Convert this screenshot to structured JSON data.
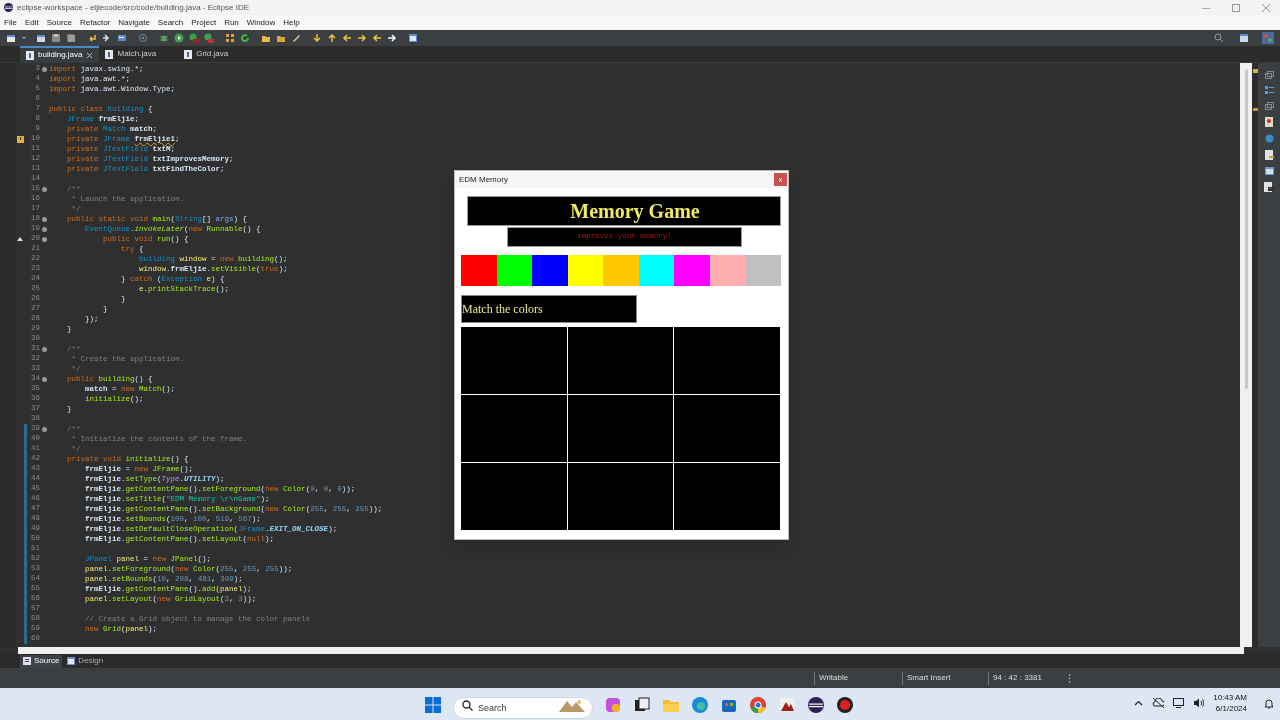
{
  "window": {
    "title": "eclipse-workspace - eljiecode/src/code/building.java - Eclipse IDE"
  },
  "menu": [
    "File",
    "Edit",
    "Source",
    "Refactor",
    "Navigate",
    "Search",
    "Project",
    "Run",
    "Window",
    "Help"
  ],
  "editor_tabs": [
    {
      "label": "building.java",
      "selected": true
    },
    {
      "label": "Match.java",
      "selected": false
    },
    {
      "label": "Grid.java",
      "selected": false
    }
  ],
  "code_lines": [
    {
      "number": "3",
      "fold": true,
      "changed": false,
      "tokens": [
        {
          "kind": "kw",
          "text": "import"
        },
        {
          "kind": "plain",
          "text": " javax.swing.*;"
        }
      ]
    },
    {
      "number": "4",
      "fold": false,
      "changed": false,
      "tokens": [
        {
          "kind": "kw",
          "text": "import"
        },
        {
          "kind": "plain",
          "text": " java.awt.*;"
        }
      ]
    },
    {
      "number": "5",
      "fold": false,
      "changed": false,
      "tokens": [
        {
          "kind": "kw",
          "text": "import"
        },
        {
          "kind": "plain",
          "text": " java.awt.Window.Type;"
        }
      ]
    },
    {
      "number": "6",
      "fold": false,
      "changed": false
    },
    {
      "number": "7",
      "fold": false,
      "changed": false,
      "tokens": [
        {
          "kind": "kw",
          "text": "public class "
        },
        {
          "kind": "type",
          "text": "building"
        },
        {
          "kind": "plain",
          "text": " {"
        }
      ]
    },
    {
      "number": "8",
      "fold": false,
      "changed": false,
      "tokens": [
        {
          "kind": "type",
          "text": "    JFrame "
        },
        {
          "kind": "field",
          "text": "frmEljie"
        },
        {
          "kind": "plain",
          "text": ";"
        }
      ]
    },
    {
      "number": "9",
      "fold": false,
      "changed": false,
      "tokens": [
        {
          "kind": "kw",
          "text": "    private "
        },
        {
          "kind": "type",
          "text": "Match "
        },
        {
          "kind": "field",
          "text": "match"
        },
        {
          "kind": "plain",
          "text": ";"
        }
      ]
    },
    {
      "number": "10",
      "fold": false,
      "changed": false,
      "marker": {
        "kind": "warning"
      },
      "tokens": [
        {
          "kind": "kw",
          "text": "    private "
        },
        {
          "kind": "type",
          "text": "JFrame "
        },
        {
          "kind": "warn",
          "text": "frmEljie1"
        },
        {
          "kind": "plain",
          "text": ";"
        }
      ]
    },
    {
      "number": "11",
      "fold": false,
      "changed": false,
      "tokens": [
        {
          "kind": "kw",
          "text": "    private "
        },
        {
          "kind": "type",
          "text": "JTextField "
        },
        {
          "kind": "field",
          "text": "txtM"
        },
        {
          "kind": "plain",
          "text": ";"
        }
      ]
    },
    {
      "number": "12",
      "fold": false,
      "changed": false,
      "tokens": [
        {
          "kind": "kw",
          "text": "    private "
        },
        {
          "kind": "type",
          "text": "JTextField "
        },
        {
          "kind": "field",
          "text": "txtImprovesMemory"
        },
        {
          "kind": "plain",
          "text": ";"
        }
      ]
    },
    {
      "number": "13",
      "fold": false,
      "changed": false,
      "tokens": [
        {
          "kind": "kw",
          "text": "    private "
        },
        {
          "kind": "type",
          "text": "JTextField "
        },
        {
          "kind": "field",
          "text": "txtFindTheColor"
        },
        {
          "kind": "plain",
          "text": ";"
        }
      ]
    },
    {
      "number": "14",
      "fold": false,
      "changed": false
    },
    {
      "number": "15",
      "fold": true,
      "changed": false,
      "tokens": [
        {
          "kind": "com",
          "text": "    /**"
        }
      ]
    },
    {
      "number": "16",
      "fold": false,
      "changed": false,
      "tokens": [
        {
          "kind": "com",
          "text": "     * Launch the application."
        }
      ]
    },
    {
      "number": "17",
      "fold": false,
      "changed": false,
      "tokens": [
        {
          "kind": "com",
          "text": "     */"
        }
      ]
    },
    {
      "number": "18",
      "fold": true,
      "changed": false,
      "tokens": [
        {
          "kind": "kw",
          "text": "    public static void "
        },
        {
          "kind": "method",
          "text": "main"
        },
        {
          "kind": "plain",
          "text": "("
        },
        {
          "kind": "type",
          "text": "String"
        },
        {
          "kind": "plain",
          "text": "[] "
        },
        {
          "kind": "param",
          "text": "args"
        },
        {
          "kind": "plain",
          "text": ") {"
        }
      ]
    },
    {
      "number": "19",
      "fold": true,
      "changed": false,
      "tokens": [
        {
          "kind": "type",
          "text": "        EventQueue"
        },
        {
          "kind": "plain",
          "text": "."
        },
        {
          "kind": "smethod",
          "text": "invokeLater"
        },
        {
          "kind": "plain",
          "text": "("
        },
        {
          "kind": "kw",
          "text": "new "
        },
        {
          "kind": "method",
          "text": "Runnable"
        },
        {
          "kind": "plain",
          "text": "() {"
        }
      ]
    },
    {
      "number": "20",
      "fold": true,
      "changed": false,
      "marker": {
        "kind": "override"
      },
      "tokens": [
        {
          "kind": "kw",
          "text": "            public void "
        },
        {
          "kind": "method",
          "text": "run"
        },
        {
          "kind": "plain",
          "text": "() {"
        }
      ]
    },
    {
      "number": "21",
      "fold": false,
      "changed": false,
      "tokens": [
        {
          "kind": "kw",
          "text": "                try"
        },
        {
          "kind": "plain",
          "text": " {"
        }
      ]
    },
    {
      "number": "22",
      "fold": false,
      "changed": false,
      "tokens": [
        {
          "kind": "type",
          "text": "                    building "
        },
        {
          "kind": "local",
          "text": "window"
        },
        {
          "kind": "plain",
          "text": " = "
        },
        {
          "kind": "kw",
          "text": "new "
        },
        {
          "kind": "method",
          "text": "building"
        },
        {
          "kind": "plain",
          "text": "();"
        }
      ]
    },
    {
      "number": "23",
      "fold": false,
      "changed": false,
      "tokens": [
        {
          "kind": "local",
          "text": "                    window"
        },
        {
          "kind": "plain",
          "text": "."
        },
        {
          "kind": "field",
          "text": "frmEljie"
        },
        {
          "kind": "plain",
          "text": "."
        },
        {
          "kind": "method",
          "text": "setVisible"
        },
        {
          "kind": "plain",
          "text": "("
        },
        {
          "kind": "kw",
          "text": "true"
        },
        {
          "kind": "plain",
          "text": ");"
        }
      ]
    },
    {
      "number": "24",
      "fold": false,
      "changed": false,
      "tokens": [
        {
          "kind": "plain",
          "text": "                } "
        },
        {
          "kind": "kw",
          "text": "catch"
        },
        {
          "kind": "plain",
          "text": " ("
        },
        {
          "kind": "type",
          "text": "Exception "
        },
        {
          "kind": "local",
          "text": "e"
        },
        {
          "kind": "plain",
          "text": ") {"
        }
      ]
    },
    {
      "number": "25",
      "fold": false,
      "changed": false,
      "tokens": [
        {
          "kind": "local",
          "text": "                    e"
        },
        {
          "kind": "plain",
          "text": "."
        },
        {
          "kind": "method",
          "text": "printStackTrace"
        },
        {
          "kind": "plain",
          "text": "();"
        }
      ]
    },
    {
      "number": "26",
      "fold": false,
      "changed": false,
      "tokens": [
        {
          "kind": "plain",
          "text": "                }"
        }
      ]
    },
    {
      "number": "27",
      "fold": false,
      "changed": false,
      "tokens": [
        {
          "kind": "plain",
          "text": "            }"
        }
      ]
    },
    {
      "number": "28",
      "fold": false,
      "changed": false,
      "tokens": [
        {
          "kind": "plain",
          "text": "        });"
        }
      ]
    },
    {
      "number": "29",
      "fold": false,
      "changed": false,
      "tokens": [
        {
          "kind": "plain",
          "text": "    }"
        }
      ]
    },
    {
      "number": "30",
      "fold": false,
      "changed": false
    },
    {
      "number": "31",
      "fold": true,
      "changed": false,
      "tokens": [
        {
          "kind": "com",
          "text": "    /**"
        }
      ]
    },
    {
      "number": "32",
      "fold": false,
      "changed": false,
      "tokens": [
        {
          "kind": "com",
          "text": "     * Create the application."
        }
      ]
    },
    {
      "number": "33",
      "fold": false,
      "changed": false,
      "tokens": [
        {
          "kind": "com",
          "text": "     */"
        }
      ]
    },
    {
      "number": "34",
      "fold": true,
      "changed": false,
      "tokens": [
        {
          "kind": "kw",
          "text": "    public "
        },
        {
          "kind": "method",
          "text": "building"
        },
        {
          "kind": "plain",
          "text": "() {"
        }
      ]
    },
    {
      "number": "35",
      "fold": false,
      "changed": false,
      "tokens": [
        {
          "kind": "field",
          "text": "        match"
        },
        {
          "kind": "plain",
          "text": " = "
        },
        {
          "kind": "kw",
          "text": "new "
        },
        {
          "kind": "method",
          "text": "Match"
        },
        {
          "kind": "plain",
          "text": "();"
        }
      ]
    },
    {
      "number": "36",
      "fold": false,
      "changed": false,
      "tokens": [
        {
          "kind": "method",
          "text": "        initialize"
        },
        {
          "kind": "plain",
          "text": "();"
        }
      ]
    },
    {
      "number": "37",
      "fold": false,
      "changed": false,
      "tokens": [
        {
          "kind": "plain",
          "text": "    }"
        }
      ]
    },
    {
      "number": "38",
      "fold": false,
      "changed": false
    },
    {
      "number": "39",
      "fold": true,
      "changed": true,
      "tokens": [
        {
          "kind": "com",
          "text": "    /**"
        }
      ]
    },
    {
      "number": "40",
      "fold": false,
      "changed": true,
      "tokens": [
        {
          "kind": "com",
          "text": "     * Initialize the contents of the frame."
        }
      ]
    },
    {
      "number": "41",
      "fold": false,
      "changed": true,
      "tokens": [
        {
          "kind": "com",
          "text": "     */"
        }
      ]
    },
    {
      "number": "42",
      "fold": false,
      "changed": true,
      "tokens": [
        {
          "kind": "kw",
          "text": "    private void "
        },
        {
          "kind": "method",
          "text": "initialize"
        },
        {
          "kind": "plain",
          "text": "() {"
        }
      ]
    },
    {
      "number": "43",
      "fold": false,
      "changed": true,
      "tokens": [
        {
          "kind": "field",
          "text": "        frmEljie"
        },
        {
          "kind": "plain",
          "text": " = "
        },
        {
          "kind": "kw",
          "text": "new "
        },
        {
          "kind": "method",
          "text": "JFrame"
        },
        {
          "kind": "plain",
          "text": "();"
        }
      ]
    },
    {
      "number": "44",
      "fold": false,
      "changed": true,
      "tokens": [
        {
          "kind": "field",
          "text": "        frmEljie"
        },
        {
          "kind": "plain",
          "text": "."
        },
        {
          "kind": "method",
          "text": "setType"
        },
        {
          "kind": "plain",
          "text": "("
        },
        {
          "kind": "itype",
          "text": "Type"
        },
        {
          "kind": "plain",
          "text": "."
        },
        {
          "kind": "const",
          "text": "UTILITY"
        },
        {
          "kind": "plain",
          "text": ");"
        }
      ]
    },
    {
      "number": "45",
      "fold": false,
      "changed": true,
      "tokens": [
        {
          "kind": "field",
          "text": "        frmEljie"
        },
        {
          "kind": "plain",
          "text": "."
        },
        {
          "kind": "method",
          "text": "getContentPane"
        },
        {
          "kind": "plain",
          "text": "()."
        },
        {
          "kind": "method",
          "text": "setForeground"
        },
        {
          "kind": "plain",
          "text": "("
        },
        {
          "kind": "kw",
          "text": "new "
        },
        {
          "kind": "method",
          "text": "Color"
        },
        {
          "kind": "plain",
          "text": "("
        },
        {
          "kind": "num",
          "text": "0"
        },
        {
          "kind": "plain",
          "text": ", "
        },
        {
          "kind": "num",
          "text": "0"
        },
        {
          "kind": "plain",
          "text": ", "
        },
        {
          "kind": "num",
          "text": "0"
        },
        {
          "kind": "plain",
          "text": "));"
        }
      ]
    },
    {
      "number": "46",
      "fold": false,
      "changed": true,
      "tokens": [
        {
          "kind": "field",
          "text": "        frmEljie"
        },
        {
          "kind": "plain",
          "text": "."
        },
        {
          "kind": "method",
          "text": "setTitle"
        },
        {
          "kind": "plain",
          "text": "("
        },
        {
          "kind": "str",
          "text": "\"EDM Memory \\r\\nGame\""
        },
        {
          "kind": "plain",
          "text": ");"
        }
      ]
    },
    {
      "number": "47",
      "fold": false,
      "changed": true,
      "tokens": [
        {
          "kind": "field",
          "text": "        frmEljie"
        },
        {
          "kind": "plain",
          "text": "."
        },
        {
          "kind": "method",
          "text": "getContentPane"
        },
        {
          "kind": "plain",
          "text": "()."
        },
        {
          "kind": "method",
          "text": "setBackground"
        },
        {
          "kind": "plain",
          "text": "("
        },
        {
          "kind": "kw",
          "text": "new "
        },
        {
          "kind": "method",
          "text": "Color"
        },
        {
          "kind": "plain",
          "text": "("
        },
        {
          "kind": "num",
          "text": "255"
        },
        {
          "kind": "plain",
          "text": ", "
        },
        {
          "kind": "num",
          "text": "255"
        },
        {
          "kind": "plain",
          "text": ", "
        },
        {
          "kind": "num",
          "text": "255"
        },
        {
          "kind": "plain",
          "text": "));"
        }
      ]
    },
    {
      "number": "48",
      "fold": false,
      "changed": true,
      "tokens": [
        {
          "kind": "field",
          "text": "        frmEljie"
        },
        {
          "kind": "plain",
          "text": "."
        },
        {
          "kind": "method",
          "text": "setBounds"
        },
        {
          "kind": "plain",
          "text": "("
        },
        {
          "kind": "num",
          "text": "100"
        },
        {
          "kind": "plain",
          "text": ", "
        },
        {
          "kind": "num",
          "text": "100"
        },
        {
          "kind": "plain",
          "text": ", "
        },
        {
          "kind": "num",
          "text": "519"
        },
        {
          "kind": "plain",
          "text": ", "
        },
        {
          "kind": "num",
          "text": "567"
        },
        {
          "kind": "plain",
          "text": ");"
        }
      ]
    },
    {
      "number": "49",
      "fold": false,
      "changed": true,
      "tokens": [
        {
          "kind": "field",
          "text": "        frmEljie"
        },
        {
          "kind": "plain",
          "text": "."
        },
        {
          "kind": "method",
          "text": "setDefaultCloseOperation"
        },
        {
          "kind": "plain",
          "text": "("
        },
        {
          "kind": "type",
          "text": "JFrame"
        },
        {
          "kind": "plain",
          "text": "."
        },
        {
          "kind": "const",
          "text": "EXIT_ON_CLOSE"
        },
        {
          "kind": "plain",
          "text": ");"
        }
      ]
    },
    {
      "number": "50",
      "fold": false,
      "changed": true,
      "tokens": [
        {
          "kind": "field",
          "text": "        frmEljie"
        },
        {
          "kind": "plain",
          "text": "."
        },
        {
          "kind": "method",
          "text": "getContentPane"
        },
        {
          "kind": "plain",
          "text": "()."
        },
        {
          "kind": "method",
          "text": "setLayout"
        },
        {
          "kind": "plain",
          "text": "("
        },
        {
          "kind": "kw",
          "text": "null"
        },
        {
          "kind": "plain",
          "text": ");"
        }
      ]
    },
    {
      "number": "51",
      "fold": false,
      "changed": true
    },
    {
      "number": "52",
      "fold": false,
      "changed": true,
      "tokens": [
        {
          "kind": "type",
          "text": "        JPanel "
        },
        {
          "kind": "local",
          "text": "panel"
        },
        {
          "kind": "plain",
          "text": " = "
        },
        {
          "kind": "kw",
          "text": "new "
        },
        {
          "kind": "method",
          "text": "JPanel"
        },
        {
          "kind": "plain",
          "text": "();"
        }
      ]
    },
    {
      "number": "53",
      "fold": false,
      "changed": true,
      "tokens": [
        {
          "kind": "local",
          "text": "        panel"
        },
        {
          "kind": "plain",
          "text": "."
        },
        {
          "kind": "method",
          "text": "setForeground"
        },
        {
          "kind": "plain",
          "text": "("
        },
        {
          "kind": "kw",
          "text": "new "
        },
        {
          "kind": "method",
          "text": "Color"
        },
        {
          "kind": "plain",
          "text": "("
        },
        {
          "kind": "num",
          "text": "255"
        },
        {
          "kind": "plain",
          "text": ", "
        },
        {
          "kind": "num",
          "text": "255"
        },
        {
          "kind": "plain",
          "text": ", "
        },
        {
          "kind": "num",
          "text": "255"
        },
        {
          "kind": "plain",
          "text": "));"
        }
      ]
    },
    {
      "number": "54",
      "fold": false,
      "changed": true,
      "tokens": [
        {
          "kind": "local",
          "text": "        panel"
        },
        {
          "kind": "plain",
          "text": "."
        },
        {
          "kind": "method",
          "text": "setBounds"
        },
        {
          "kind": "plain",
          "text": "("
        },
        {
          "kind": "num",
          "text": "10"
        },
        {
          "kind": "plain",
          "text": ", "
        },
        {
          "kind": "num",
          "text": "208"
        },
        {
          "kind": "plain",
          "text": ", "
        },
        {
          "kind": "num",
          "text": "481"
        },
        {
          "kind": "plain",
          "text": ", "
        },
        {
          "kind": "num",
          "text": "309"
        },
        {
          "kind": "plain",
          "text": ");"
        }
      ]
    },
    {
      "number": "55",
      "fold": false,
      "changed": true,
      "tokens": [
        {
          "kind": "field",
          "text": "        frmEljie"
        },
        {
          "kind": "plain",
          "text": "."
        },
        {
          "kind": "method",
          "text": "getContentPane"
        },
        {
          "kind": "plain",
          "text": "()."
        },
        {
          "kind": "method",
          "text": "add"
        },
        {
          "kind": "plain",
          "text": "("
        },
        {
          "kind": "local",
          "text": "panel"
        },
        {
          "kind": "plain",
          "text": ");"
        }
      ]
    },
    {
      "number": "56",
      "fold": false,
      "changed": true,
      "tokens": [
        {
          "kind": "local",
          "text": "        panel"
        },
        {
          "kind": "plain",
          "text": "."
        },
        {
          "kind": "method",
          "text": "setLayout"
        },
        {
          "kind": "plain",
          "text": "("
        },
        {
          "kind": "kw",
          "text": "new "
        },
        {
          "kind": "method",
          "text": "GridLayout"
        },
        {
          "kind": "plain",
          "text": "("
        },
        {
          "kind": "num",
          "text": "3"
        },
        {
          "kind": "plain",
          "text": ", "
        },
        {
          "kind": "num",
          "text": "3"
        },
        {
          "kind": "plain",
          "text": "));"
        }
      ]
    },
    {
      "number": "57",
      "fold": false,
      "changed": true
    },
    {
      "number": "58",
      "fold": false,
      "changed": true,
      "tokens": [
        {
          "kind": "com",
          "text": "        // Create a Grid object to manage the color panels"
        }
      ]
    },
    {
      "number": "59",
      "fold": false,
      "changed": true,
      "tokens": [
        {
          "kind": "kw",
          "text": "        new "
        },
        {
          "kind": "method",
          "text": "Grid"
        },
        {
          "kind": "plain",
          "text": "("
        },
        {
          "kind": "local",
          "text": "panel"
        },
        {
          "kind": "plain",
          "text": ");"
        }
      ]
    },
    {
      "number": "60",
      "fold": false,
      "changed": true
    }
  ],
  "dialog": {
    "title": "EDM Memory",
    "close": "x",
    "heading": "Memory Game",
    "subtitle": "improves your memory!",
    "swatches": [
      {
        "color": "#ff0000"
      },
      {
        "color": "#00ff00"
      },
      {
        "color": "#0000ff"
      },
      {
        "color": "#ffff00"
      },
      {
        "color": "#ffc800"
      },
      {
        "color": "#00ffff"
      },
      {
        "color": "#ff00ff"
      },
      {
        "color": "#ffafaf"
      },
      {
        "color": "#c0c0c0"
      }
    ],
    "prompt": "Match the colors",
    "grid_cells": [
      {
        "kind": "tile"
      },
      {
        "kind": "tile"
      },
      {
        "kind": "tile"
      },
      {
        "kind": "tile"
      },
      {
        "kind": "tile"
      },
      {
        "kind": "tile"
      },
      {
        "kind": "tile"
      },
      {
        "kind": "tile"
      },
      {
        "kind": "tile"
      }
    ]
  },
  "bottom_tabs": [
    {
      "label": "Source",
      "selected": true
    },
    {
      "label": "Design",
      "selected": false
    }
  ],
  "status_bar": [
    "Writable",
    "Smart Insert",
    "94 : 42 : 3381"
  ],
  "taskbar": {
    "search_placeholder": "Search",
    "time": "10:43 AM",
    "date": "6/1/2024"
  }
}
